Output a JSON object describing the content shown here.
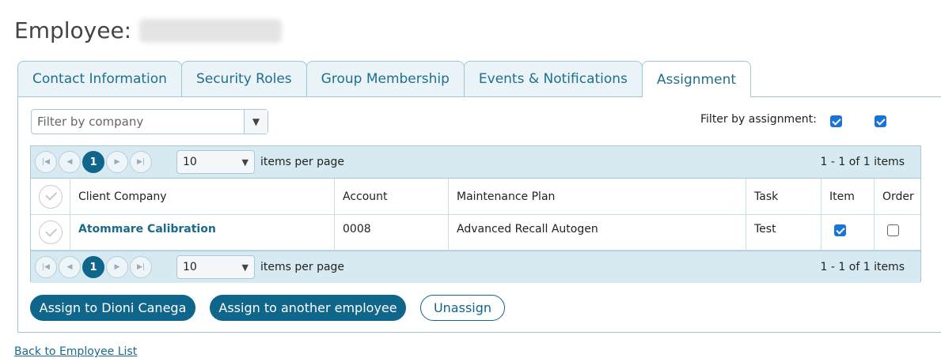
{
  "page": {
    "title_prefix": "Employee:"
  },
  "tabs": [
    {
      "label": "Contact Information"
    },
    {
      "label": "Security Roles"
    },
    {
      "label": "Group Membership"
    },
    {
      "label": "Events & Notifications"
    },
    {
      "label": "Assignment"
    }
  ],
  "active_tab": "Assignment",
  "filter": {
    "company_placeholder": "Filter by company",
    "assignment_label": "Filter by assignment:",
    "assignment_item_checked": true,
    "assignment_order_checked": true
  },
  "pager": {
    "current_page": "1",
    "per_page": "10",
    "per_page_label": "items per page",
    "range": "1 - 1 of 1 items"
  },
  "table": {
    "columns": [
      "Client Company",
      "Account",
      "Maintenance Plan",
      "Task",
      "Item",
      "Order"
    ],
    "rows": [
      {
        "company": "Atommare Calibration",
        "account": "0008",
        "plan": "Advanced Recall Autogen",
        "task": "Test",
        "item": true,
        "order": false
      }
    ]
  },
  "actions": {
    "assign_self": "Assign to Dioni Canega",
    "assign_other": "Assign to another employee",
    "unassign": "Unassign"
  },
  "footer": {
    "back_link": "Back to Employee List"
  },
  "colors": {
    "accent": "#10658a",
    "tab_text": "#1f6f8b",
    "checkbox": "#1a73d9"
  }
}
